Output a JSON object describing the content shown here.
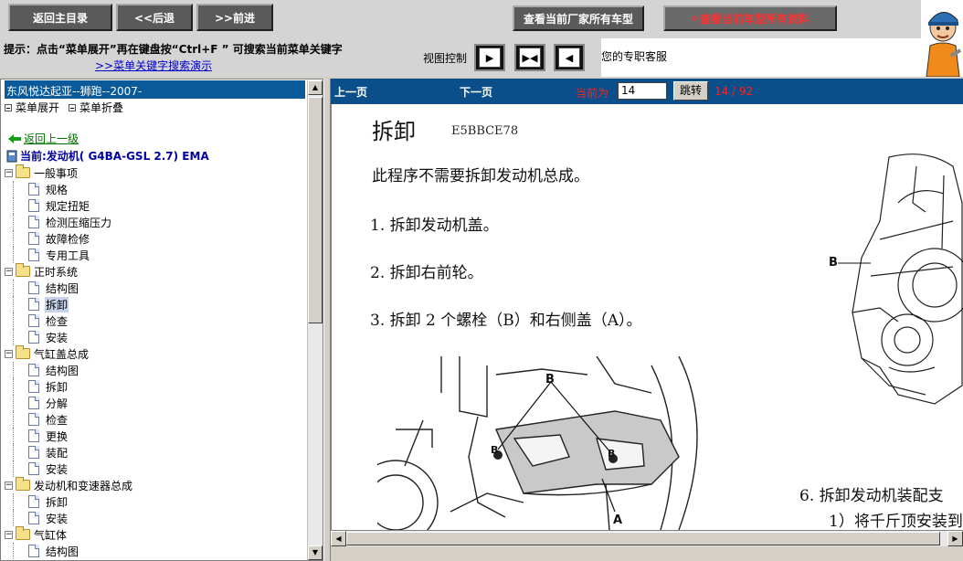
{
  "topbar": {
    "home_label": "返回主目录",
    "back_label": "<<后退",
    "forward_label": ">>前进",
    "all_models_label": "查看当前厂家所有车型",
    "all_docs_label": "查看当前车型所有资料"
  },
  "hint": {
    "text": "提示：点击“菜单展开”再在键盘按“Ctrl+F ”  可搜索当前菜单关键字",
    "demo_link": ">>菜单关键字搜索演示",
    "view_control_label": "视图控制",
    "service_text": "您的专职客服"
  },
  "sidebar": {
    "title": "东风悦达起亚--狮跑--2007-",
    "expand_label": "菜单展开",
    "collapse_label": "菜单折叠",
    "back_label": "返回上一级",
    "current_label": "当前:发动机( G4BA-GSL 2.7)  EMA",
    "groups": [
      {
        "label": "一般事项",
        "children": [
          "规格",
          "规定扭矩",
          "检测压缩压力",
          "故障检修",
          "专用工具"
        ]
      },
      {
        "label": "正时系统",
        "children": [
          "结构图",
          "拆卸",
          "检查",
          "安装"
        ]
      },
      {
        "label": "气缸盖总成",
        "children": [
          "结构图",
          "拆卸",
          "分解",
          "检查",
          "更换",
          "装配",
          "安装"
        ]
      },
      {
        "label": "发动机和变速器总成",
        "children": [
          "拆卸",
          "安装"
        ]
      },
      {
        "label": "气缸体",
        "children": [
          "结构图"
        ]
      }
    ],
    "selected": "正时系统/拆卸"
  },
  "viewer": {
    "prev_label": "上一页",
    "next_label": "下一页",
    "current_label": "当前为",
    "page_value": "14",
    "jump_label": "跳转",
    "page_count": "14 / 92"
  },
  "document": {
    "title": "拆卸",
    "code": "E5BBCE78",
    "intro": "此程序不需要拆卸发动机总成。",
    "steps": [
      "1.  拆卸发动机盖。",
      "2.  拆卸右前轮。",
      "3.  拆卸 2 个螺栓（B）和右侧盖（A）。"
    ],
    "step6": "6.  拆卸发动机装配支",
    "step6_sub": "1）将千斤顶安装到",
    "figure_labels": {
      "b_main": "B",
      "b_top": "B",
      "b_mid": "B",
      "b_mid2": "B",
      "a": "A"
    }
  },
  "colors": {
    "nav_blue": "#0a4f8a",
    "accent_red": "#ff3030"
  }
}
